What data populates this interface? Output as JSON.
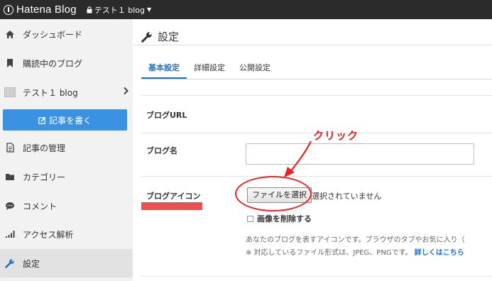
{
  "topbar": {
    "logo": "Hatena Blog",
    "blog_selector": "テスト１ blog",
    "blog_selector_caret": "▼"
  },
  "sidebar": {
    "items": [
      {
        "label": "ダッシュボード",
        "icon": "home-icon"
      },
      {
        "label": "購読中のブログ",
        "icon": "bookmark-icon"
      },
      {
        "label": "テスト１ blog",
        "icon": "blog-thumbnail-icon"
      },
      {
        "label": "記事の管理",
        "icon": "document-icon"
      },
      {
        "label": "カテゴリー",
        "icon": "folder-icon"
      },
      {
        "label": "コメント",
        "icon": "comment-icon"
      },
      {
        "label": "アクセス解析",
        "icon": "bar-chart-icon"
      },
      {
        "label": "設定",
        "icon": "wrench-icon"
      }
    ],
    "write_button": "記事を書く",
    "active_item": "設定"
  },
  "main": {
    "title": "設定",
    "tabs": [
      {
        "label": "基本設定",
        "active": true
      },
      {
        "label": "詳細設定",
        "active": false
      },
      {
        "label": "公開設定",
        "active": false
      }
    ],
    "blog_url_label": "ブログURL",
    "blog_name_label": "ブログ名",
    "blog_name_value": "",
    "blog_icon_label": "ブログアイコン",
    "file_button": "ファイルを選択",
    "file_status": "選択されていません",
    "delete_image_label": "画像を削除する",
    "description_line1": "あなたのブログを表すアイコンです。ブラウザのタブやお気に入り（",
    "description_line2": "※ 対応しているファイル形式は、JPEG、PNGです。",
    "details_link": "詳しくはこちら"
  },
  "annotation": {
    "text": "クリック",
    "color": "#e02020"
  },
  "colors": {
    "topbar": "#2b2b2b",
    "accent": "#3a92e0",
    "tab_active": "#1c6fcc",
    "annotation_red": "#ef4f4f"
  }
}
